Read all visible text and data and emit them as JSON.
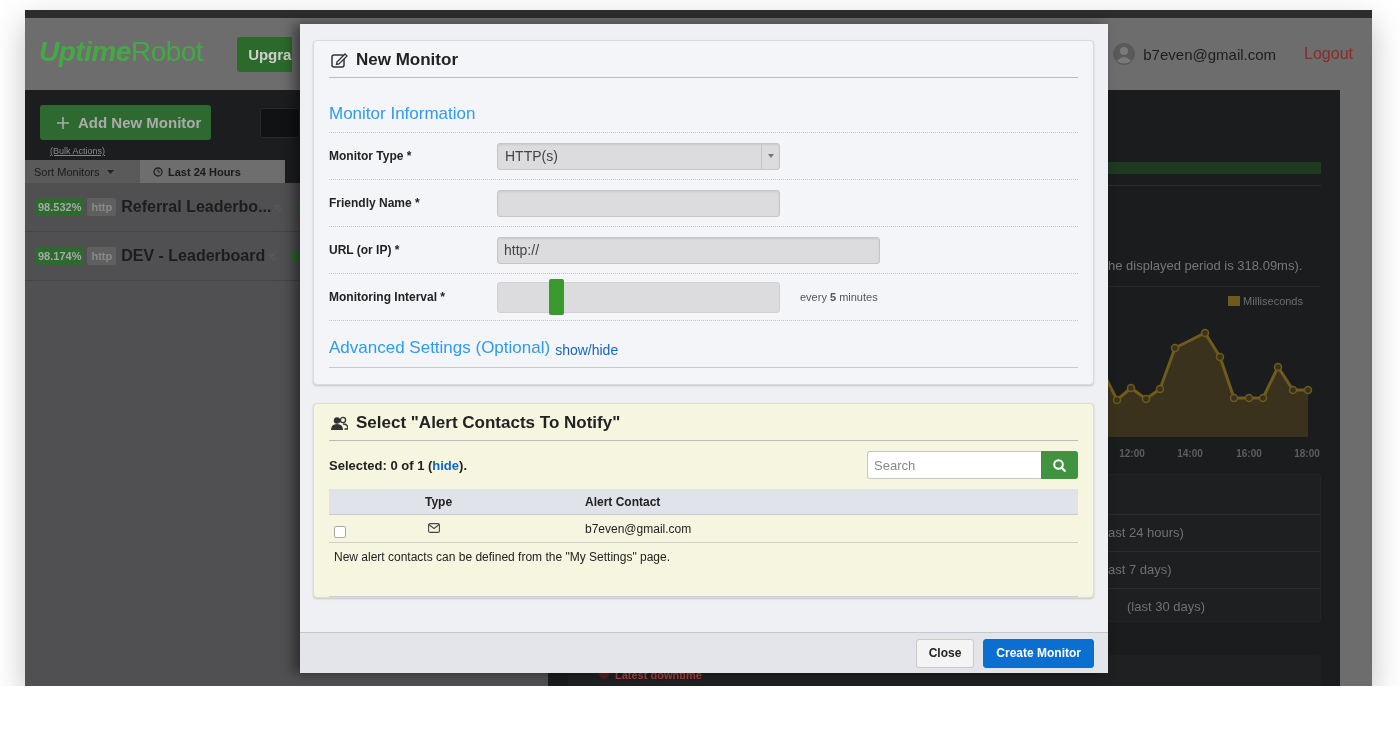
{
  "app_header": {
    "logo": "**Uptime**Robot",
    "upgrade_button": "Upgra",
    "user_email": "b7even@gmail.com",
    "logout": "Logout"
  },
  "sidebar": {
    "add_button": "Add New Monitor",
    "bulk_actions": "(Bulk Actions)",
    "sort_dropdown": "Sort Monitors",
    "period_tab": "Last 24 Hours",
    "monitors": [
      {
        "uptime": "98.532%",
        "type": "http",
        "name": "Referral Leaderbo..."
      },
      {
        "uptime": "98.174%",
        "type": "http",
        "name": "DEV - Leaderboard"
      }
    ]
  },
  "main_panel": {
    "response_note": "he displayed period is 318.09ms).",
    "legend": "Milliseconds",
    "x_labels": [
      "12:00",
      "14:00",
      "16:00",
      "18:00"
    ],
    "stats": [
      "ast 24 hours)",
      "ast 7 days)",
      "(last 30 days)"
    ],
    "latest_downtime": "Latest downtime"
  },
  "modal": {
    "monitor_card": {
      "title": "New Monitor",
      "section": "Monitor Information",
      "fields": [
        {
          "kind": "select",
          "label": "Monitor Type *",
          "value": "HTTP(s)"
        },
        {
          "kind": "text",
          "label": "Friendly Name *"
        },
        {
          "kind": "url",
          "label": "URL (or IP) *",
          "value": "http://"
        },
        {
          "kind": "slider",
          "label": "Monitoring Interval *",
          "level": 0.19,
          "reading": "every **5** minutes"
        }
      ],
      "advanced": {
        "title": "Advanced Settings (Optional)",
        "link": "show/hide"
      }
    },
    "contacts_card": {
      "title": "Select \"Alert Contacts To Notify\"",
      "summary": {
        "text": "Selected: 0 of 1 (",
        "link": "hide",
        "end": ")."
      },
      "search": {
        "placeholder": "Search"
      },
      "columns": [
        "Type",
        "Alert Contact"
      ],
      "rows": [
        {
          "checked": false,
          "contact": "b7even@gmail.com"
        }
      ],
      "note": "New alert contacts can be defined from the \"My Settings\" page."
    },
    "footer_buttons": [
      {
        "label": "Close",
        "kind": "default"
      },
      {
        "label": "Create Monitor",
        "kind": "primary"
      }
    ]
  }
}
